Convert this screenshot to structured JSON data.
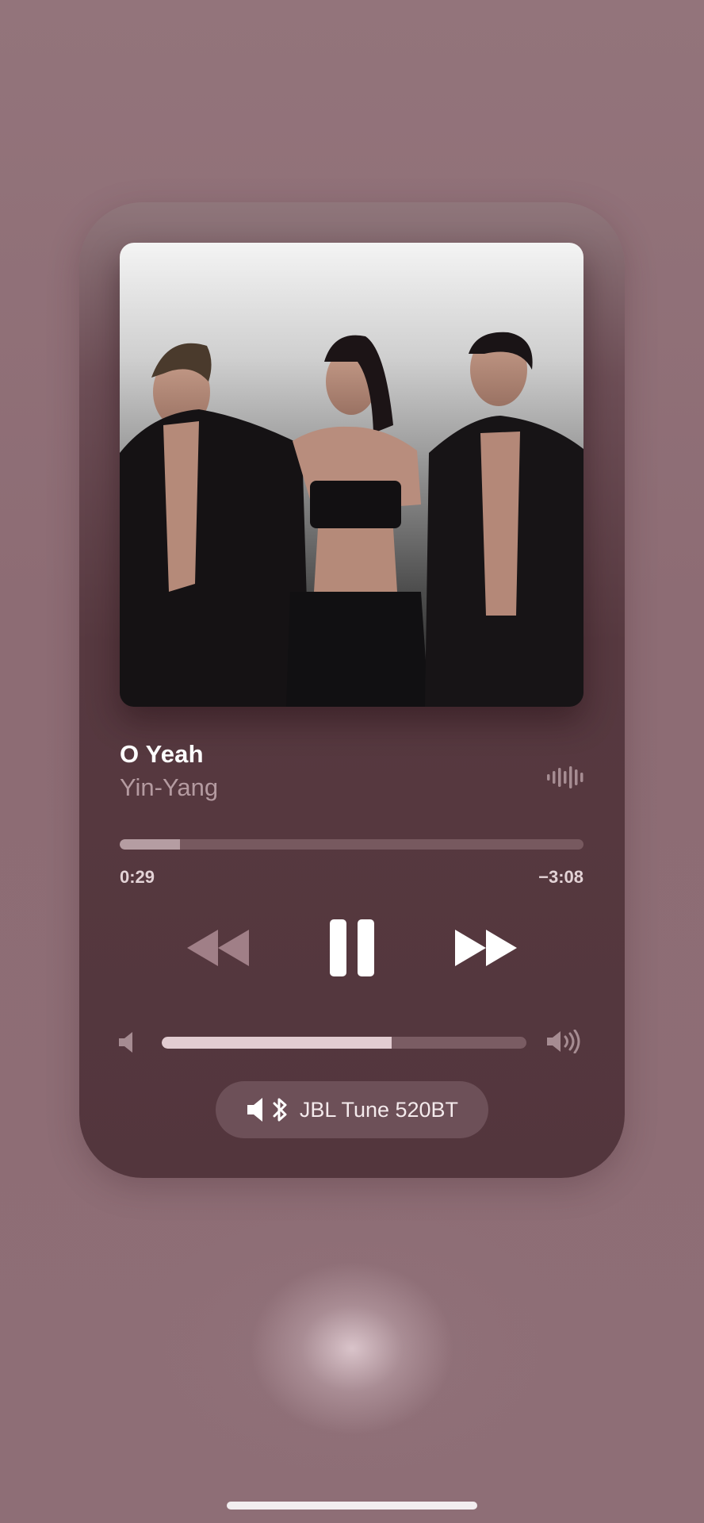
{
  "now_playing": {
    "title": "O Yeah",
    "artist": "Yin-Yang",
    "artwork_icon": "album-artwork",
    "wave_icon": "live-waveform-icon"
  },
  "playback": {
    "elapsed": "0:29",
    "remaining": "−3:08",
    "progress_fraction": 0.13
  },
  "controls": {
    "rewind_icon": "rewind-icon",
    "pause_icon": "pause-icon",
    "forward_icon": "fast-forward-icon"
  },
  "volume": {
    "level_fraction": 0.63,
    "low_icon": "speaker-low-icon",
    "high_icon": "speaker-high-icon"
  },
  "output_device": {
    "name": "JBL Tune 520BT",
    "icon": "bluetooth-speaker-icon"
  },
  "colors": {
    "background": "#8f6f77",
    "card": "#573940",
    "text_primary": "#ffffff",
    "text_secondary": "#b49aa0"
  }
}
